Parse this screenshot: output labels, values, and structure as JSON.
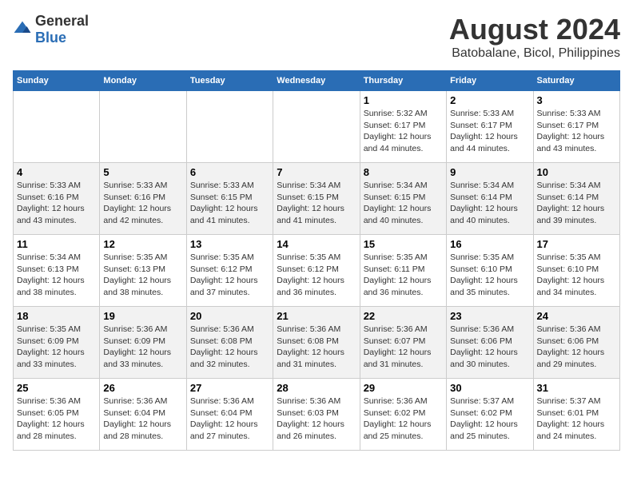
{
  "logo": {
    "general": "General",
    "blue": "Blue"
  },
  "title": "August 2024",
  "subtitle": "Batobalane, Bicol, Philippines",
  "headers": [
    "Sunday",
    "Monday",
    "Tuesday",
    "Wednesday",
    "Thursday",
    "Friday",
    "Saturday"
  ],
  "weeks": [
    [
      {
        "day": "",
        "content": ""
      },
      {
        "day": "",
        "content": ""
      },
      {
        "day": "",
        "content": ""
      },
      {
        "day": "",
        "content": ""
      },
      {
        "day": "1",
        "content": "Sunrise: 5:32 AM\nSunset: 6:17 PM\nDaylight: 12 hours\nand 44 minutes."
      },
      {
        "day": "2",
        "content": "Sunrise: 5:33 AM\nSunset: 6:17 PM\nDaylight: 12 hours\nand 44 minutes."
      },
      {
        "day": "3",
        "content": "Sunrise: 5:33 AM\nSunset: 6:17 PM\nDaylight: 12 hours\nand 43 minutes."
      }
    ],
    [
      {
        "day": "4",
        "content": "Sunrise: 5:33 AM\nSunset: 6:16 PM\nDaylight: 12 hours\nand 43 minutes."
      },
      {
        "day": "5",
        "content": "Sunrise: 5:33 AM\nSunset: 6:16 PM\nDaylight: 12 hours\nand 42 minutes."
      },
      {
        "day": "6",
        "content": "Sunrise: 5:33 AM\nSunset: 6:15 PM\nDaylight: 12 hours\nand 41 minutes."
      },
      {
        "day": "7",
        "content": "Sunrise: 5:34 AM\nSunset: 6:15 PM\nDaylight: 12 hours\nand 41 minutes."
      },
      {
        "day": "8",
        "content": "Sunrise: 5:34 AM\nSunset: 6:15 PM\nDaylight: 12 hours\nand 40 minutes."
      },
      {
        "day": "9",
        "content": "Sunrise: 5:34 AM\nSunset: 6:14 PM\nDaylight: 12 hours\nand 40 minutes."
      },
      {
        "day": "10",
        "content": "Sunrise: 5:34 AM\nSunset: 6:14 PM\nDaylight: 12 hours\nand 39 minutes."
      }
    ],
    [
      {
        "day": "11",
        "content": "Sunrise: 5:34 AM\nSunset: 6:13 PM\nDaylight: 12 hours\nand 38 minutes."
      },
      {
        "day": "12",
        "content": "Sunrise: 5:35 AM\nSunset: 6:13 PM\nDaylight: 12 hours\nand 38 minutes."
      },
      {
        "day": "13",
        "content": "Sunrise: 5:35 AM\nSunset: 6:12 PM\nDaylight: 12 hours\nand 37 minutes."
      },
      {
        "day": "14",
        "content": "Sunrise: 5:35 AM\nSunset: 6:12 PM\nDaylight: 12 hours\nand 36 minutes."
      },
      {
        "day": "15",
        "content": "Sunrise: 5:35 AM\nSunset: 6:11 PM\nDaylight: 12 hours\nand 36 minutes."
      },
      {
        "day": "16",
        "content": "Sunrise: 5:35 AM\nSunset: 6:10 PM\nDaylight: 12 hours\nand 35 minutes."
      },
      {
        "day": "17",
        "content": "Sunrise: 5:35 AM\nSunset: 6:10 PM\nDaylight: 12 hours\nand 34 minutes."
      }
    ],
    [
      {
        "day": "18",
        "content": "Sunrise: 5:35 AM\nSunset: 6:09 PM\nDaylight: 12 hours\nand 33 minutes."
      },
      {
        "day": "19",
        "content": "Sunrise: 5:36 AM\nSunset: 6:09 PM\nDaylight: 12 hours\nand 33 minutes."
      },
      {
        "day": "20",
        "content": "Sunrise: 5:36 AM\nSunset: 6:08 PM\nDaylight: 12 hours\nand 32 minutes."
      },
      {
        "day": "21",
        "content": "Sunrise: 5:36 AM\nSunset: 6:08 PM\nDaylight: 12 hours\nand 31 minutes."
      },
      {
        "day": "22",
        "content": "Sunrise: 5:36 AM\nSunset: 6:07 PM\nDaylight: 12 hours\nand 31 minutes."
      },
      {
        "day": "23",
        "content": "Sunrise: 5:36 AM\nSunset: 6:06 PM\nDaylight: 12 hours\nand 30 minutes."
      },
      {
        "day": "24",
        "content": "Sunrise: 5:36 AM\nSunset: 6:06 PM\nDaylight: 12 hours\nand 29 minutes."
      }
    ],
    [
      {
        "day": "25",
        "content": "Sunrise: 5:36 AM\nSunset: 6:05 PM\nDaylight: 12 hours\nand 28 minutes."
      },
      {
        "day": "26",
        "content": "Sunrise: 5:36 AM\nSunset: 6:04 PM\nDaylight: 12 hours\nand 28 minutes."
      },
      {
        "day": "27",
        "content": "Sunrise: 5:36 AM\nSunset: 6:04 PM\nDaylight: 12 hours\nand 27 minutes."
      },
      {
        "day": "28",
        "content": "Sunrise: 5:36 AM\nSunset: 6:03 PM\nDaylight: 12 hours\nand 26 minutes."
      },
      {
        "day": "29",
        "content": "Sunrise: 5:36 AM\nSunset: 6:02 PM\nDaylight: 12 hours\nand 25 minutes."
      },
      {
        "day": "30",
        "content": "Sunrise: 5:37 AM\nSunset: 6:02 PM\nDaylight: 12 hours\nand 25 minutes."
      },
      {
        "day": "31",
        "content": "Sunrise: 5:37 AM\nSunset: 6:01 PM\nDaylight: 12 hours\nand 24 minutes."
      }
    ]
  ]
}
